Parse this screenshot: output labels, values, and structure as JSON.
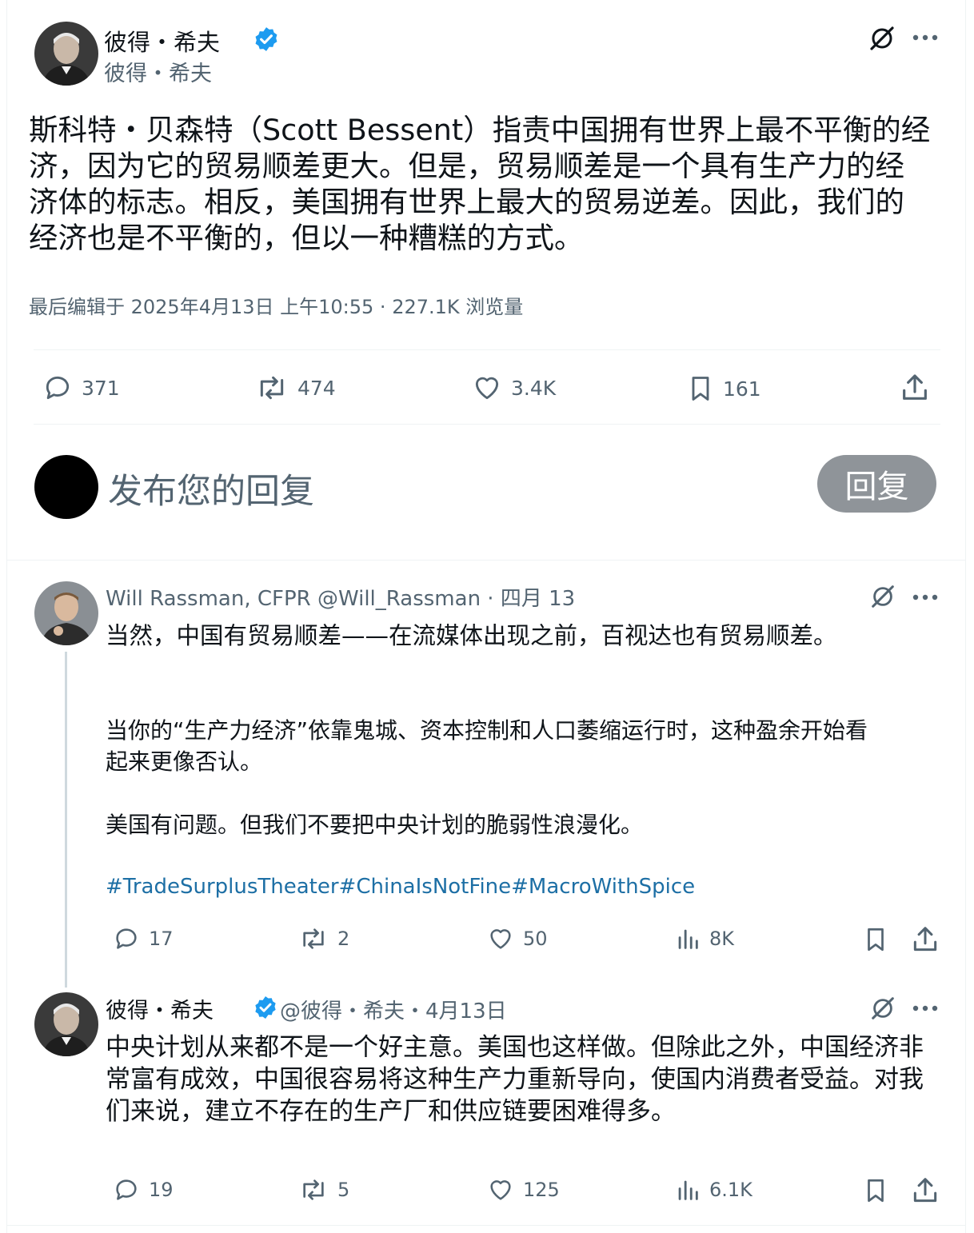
{
  "main_tweet": {
    "author_name": "彼得・希夫",
    "author_handle": "彼得・希夫",
    "verified_color": "#1d9bf0",
    "text": "斯科特・贝森特（Scott Bessent）指责中国拥有世界上最不平衡的经济，因为它的贸易顺差更大。但是，贸易顺差是一个具有生产力的经济体的标志。相反，美国拥有世界上最大的贸易逆差。因此，我们的经济也是不平衡的，但以一种糟糕的方式。",
    "meta": "最后编辑于 2025年4月13日 上午10:55 · 227.1K 浏览量",
    "actions": {
      "replies": "371",
      "retweets": "474",
      "likes": "3.4K",
      "bookmarks": "161"
    }
  },
  "composer": {
    "placeholder": "发布您的回复",
    "button_label": "回复"
  },
  "replies": [
    {
      "author_line": "Will Rassman, CFPR @Will_Rassman · 四月 13",
      "paragraphs": [
        "当然，中国有贸易顺差——在流媒体出现之前，百视达也有贸易顺差。",
        "当你的“生产力经济”依靠鬼城、资本控制和人口萎缩运行时，这种盈余开始看起来更像否认。",
        "美国有问题。但我们不要把中央计划的脆弱性浪漫化。"
      ],
      "hashtags": "#TradeSurplusTheater#ChinaIsNotFine#MacroWithSpice",
      "hashtag_color": "#1d6fa5",
      "actions": {
        "replies": "17",
        "retweets": "2",
        "likes": "50",
        "views": "8K"
      }
    },
    {
      "author_name": "彼得・希夫",
      "author_handle_date": "@彼得・希夫・4月13日",
      "text": "中央计划从来都不是一个好主意。美国也这样做。但除此之外，中国经济非常富有成效，中国很容易将这种生产力重新导向，使国内消费者受益。对我们来说，建立不存在的生产厂和供应链要困难得多。",
      "actions": {
        "replies": "19",
        "retweets": "5",
        "likes": "125",
        "views": "6.1K"
      }
    }
  ]
}
